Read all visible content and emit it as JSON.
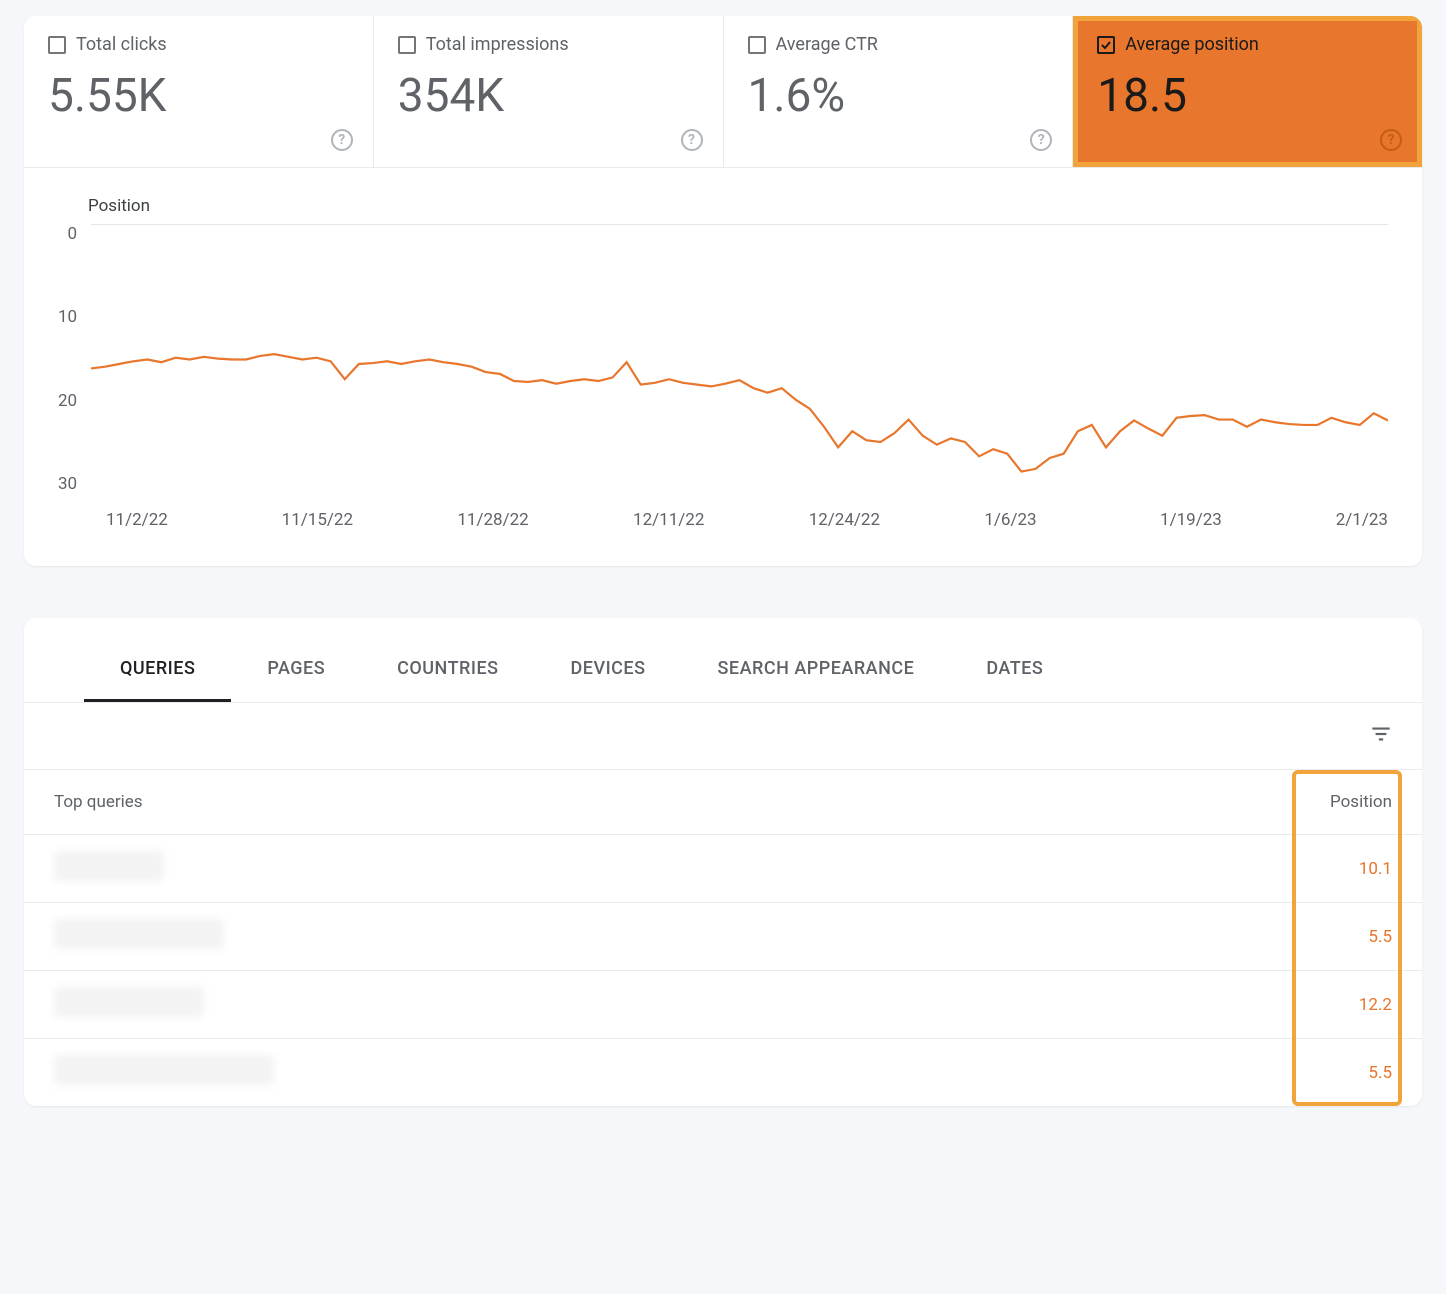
{
  "metrics": [
    {
      "label": "Total clicks",
      "value": "5.55K",
      "checked": false,
      "highlight": false
    },
    {
      "label": "Total impressions",
      "value": "354K",
      "checked": false,
      "highlight": false
    },
    {
      "label": "Average CTR",
      "value": "1.6%",
      "checked": false,
      "highlight": false
    },
    {
      "label": "Average position",
      "value": "18.5",
      "checked": true,
      "highlight": true
    }
  ],
  "tabs": [
    "QUERIES",
    "PAGES",
    "COUNTRIES",
    "DEVICES",
    "SEARCH APPEARANCE",
    "DATES"
  ],
  "active_tab": 0,
  "table": {
    "col_left": "Top queries",
    "col_right": "Position",
    "rows": [
      {
        "label_width": 110,
        "position": "10.1"
      },
      {
        "label_width": 170,
        "position": "5.5"
      },
      {
        "label_width": 150,
        "position": "12.2"
      },
      {
        "label_width": 220,
        "position": "5.5"
      }
    ]
  },
  "chart_data": {
    "type": "line",
    "title": "Position",
    "xlabel": "",
    "ylabel": "Position",
    "ylim": [
      0,
      30
    ],
    "y_ticks": [
      0,
      10,
      20,
      30
    ],
    "x_tick_labels": [
      "11/2/22",
      "11/15/22",
      "11/28/22",
      "12/11/22",
      "12/24/22",
      "1/6/23",
      "1/19/23",
      "2/1/23"
    ],
    "categories_note": "one point per day from 11/2/22 through 2/1/23",
    "values": [
      16,
      15.8,
      15.5,
      15.2,
      15,
      15.3,
      14.8,
      15,
      14.7,
      14.9,
      15,
      15,
      14.6,
      14.4,
      14.7,
      15,
      14.8,
      15.2,
      17.2,
      15.5,
      15.4,
      15.2,
      15.5,
      15.2,
      15,
      15.3,
      15.5,
      15.8,
      16.4,
      16.6,
      17.4,
      17.5,
      17.3,
      17.7,
      17.4,
      17.2,
      17.4,
      17,
      15.3,
      17.8,
      17.6,
      17.2,
      17.6,
      17.8,
      18,
      17.7,
      17.3,
      18.2,
      18.7,
      18.2,
      19.5,
      20.5,
      22.5,
      24.8,
      23,
      24,
      24.2,
      23.2,
      21.7,
      23.5,
      24.5,
      23.8,
      24.2,
      25.8,
      25,
      25.5,
      27.5,
      27.2,
      26,
      25.5,
      23,
      22.3,
      24.8,
      23,
      21.8,
      22.7,
      23.5,
      21.5,
      21.3,
      21.2,
      21.7,
      21.7,
      22.5,
      21.7,
      22,
      22.2,
      22.3,
      22.3,
      21.5,
      22,
      22.3,
      21,
      21.8
    ]
  }
}
